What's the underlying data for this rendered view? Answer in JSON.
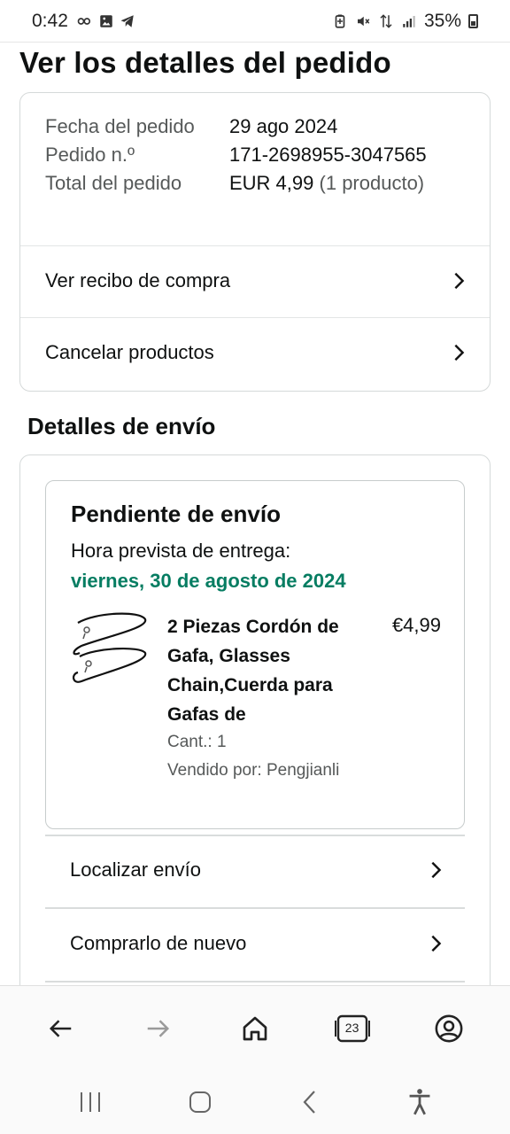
{
  "status_bar": {
    "time": "0:42",
    "battery": "35%",
    "icons": [
      "key-icon",
      "image-icon",
      "telegram-icon",
      "battery-saver-icon",
      "mute-icon",
      "data-arrows-icon",
      "signal-icon",
      "battery-icon"
    ]
  },
  "page": {
    "title": "Ver los detalles del pedido"
  },
  "order_summary": {
    "date_label": "Fecha del pedido",
    "date_value": "29 ago 2024",
    "number_label": "Pedido n.º",
    "number_value": "171-2698955-3047565",
    "total_label": "Total del pedido",
    "total_value": "EUR 4,99",
    "total_count": "(1 producto)"
  },
  "order_links": [
    {
      "label": "Ver recibo de compra"
    },
    {
      "label": "Cancelar productos"
    }
  ],
  "shipping": {
    "section_title": "Detalles de envío",
    "status": "Pendiente de envío",
    "eta_label": "Hora prevista de entrega:",
    "eta_date": "viernes, 30 de agosto de 2024",
    "eta_color": "#067d62",
    "product": {
      "title": "2 Piezas Cordón de Gafa, Glasses Chain,Cuerda para Gafas de",
      "price": "€4,99",
      "qty": "Cant.: 1",
      "seller": "Vendido por: Pengjianli"
    },
    "links": [
      {
        "label": "Localizar envío"
      },
      {
        "label": "Comprarlo de nuevo"
      }
    ]
  },
  "browser_toolbar": {
    "tabs_count": "23",
    "icons": [
      "back-arrow-icon",
      "forward-arrow-icon",
      "home-icon",
      "tabs-icon",
      "account-icon"
    ]
  },
  "system_nav": {
    "icons": [
      "recents-icon",
      "home-circle-icon",
      "back-chevron-icon",
      "accessibility-icon"
    ]
  }
}
